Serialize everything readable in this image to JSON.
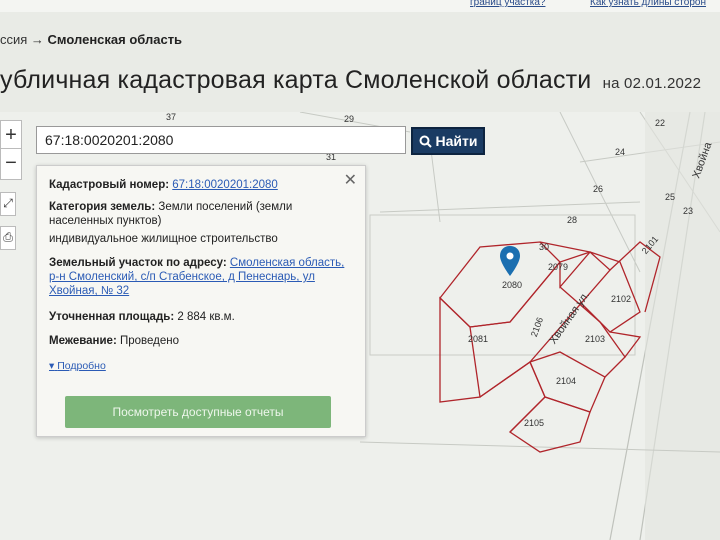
{
  "topbar": {
    "link1": "границ участка?",
    "link2": "Как узнать длины сторон"
  },
  "breadcrumb": {
    "prefix": "ссия →",
    "current": "Смоленская область"
  },
  "title": {
    "main": "убличная кадастровая карта Смоленской области",
    "date": "на 02.01.2022"
  },
  "map_controls": {
    "zoom_in": "+",
    "zoom_out": "−"
  },
  "search": {
    "value": "67:18:0020201:2080",
    "button_label": "Найти"
  },
  "popup": {
    "cad_label": "Кадастровый номер:",
    "cad_value": "67:18:0020201:2080",
    "cat_label": "Категория земель:",
    "cat_value": "Земли поселений (земли населенных пунктов)",
    "use_value": "индивидуальное жилищное строительство",
    "addr_label": "Земельный участок по адресу:",
    "addr_value": "Смоленская область, р-н Смоленский, с/п Стабенское, д Пенеснарь, ул Хвойная, № 32",
    "area_label": "Уточненная площадь:",
    "area_value": "2 884 кв.м.",
    "survey_label": "Межевание:",
    "survey_value": "Проведено",
    "more_link": "Подробно",
    "report_button": "Посмотреть доступные отчеты",
    "close": "✕"
  },
  "map": {
    "plots": [
      "2080",
      "2079",
      "2081",
      "2106",
      "2102",
      "2103",
      "2104",
      "2105",
      "2101",
      "30",
      "28",
      "26",
      "25",
      "24",
      "23",
      "22",
      "37",
      "29",
      "31"
    ],
    "street1": "Хвойная ул.",
    "street2": "Хвойна"
  },
  "colors": {
    "parcel_border": "#b0252b",
    "search_button": "#1a3b63",
    "report_button": "#7db67a"
  }
}
